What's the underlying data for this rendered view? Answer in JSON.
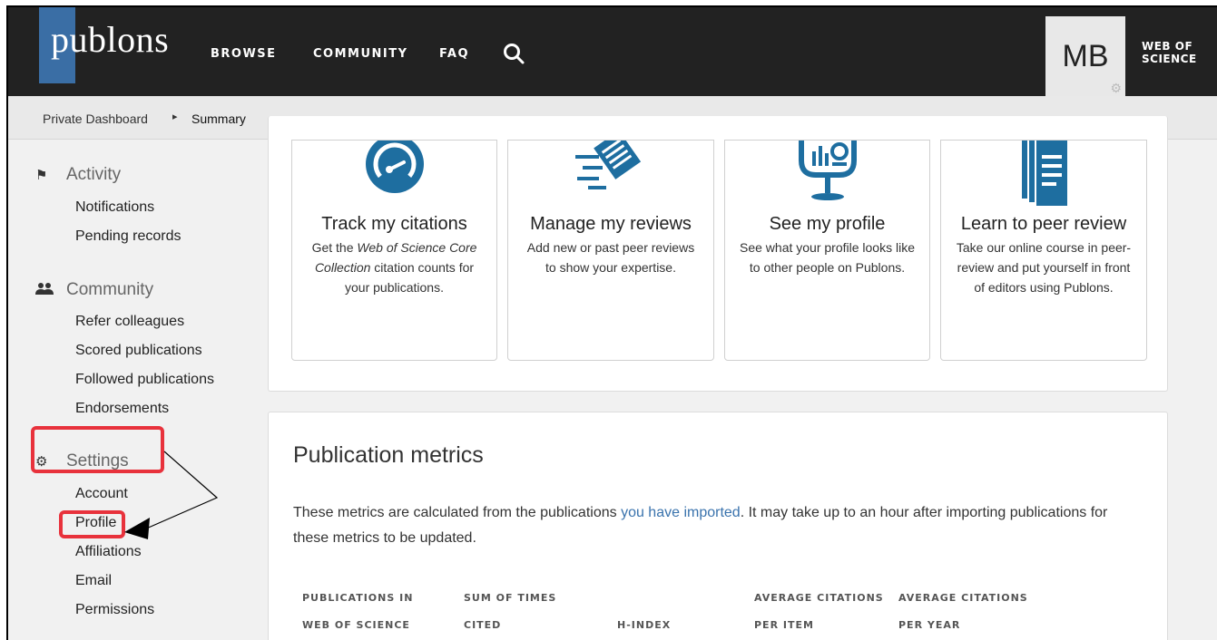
{
  "header": {
    "logo": "publons",
    "nav": [
      "BROWSE",
      "COMMUNITY",
      "FAQ"
    ],
    "avatar_initials": "MB",
    "wos_line1": "WEB OF",
    "wos_line2": "SCIENCE"
  },
  "breadcrumb": {
    "parent": "Private Dashboard",
    "current": "Summary"
  },
  "sidebar": {
    "activity": {
      "title": "Activity",
      "items": [
        "Notifications",
        "Pending records"
      ]
    },
    "community": {
      "title": "Community",
      "items": [
        "Refer colleagues",
        "Scored publications",
        "Followed publications",
        "Endorsements"
      ]
    },
    "settings": {
      "title": "Settings",
      "items": [
        "Account",
        "Profile",
        "Affiliations",
        "Email",
        "Permissions"
      ]
    }
  },
  "cards": [
    {
      "title": "Track my citations",
      "desc_pre": "Get the ",
      "desc_em": "Web of Science Core Collection",
      "desc_post": " citation counts for your publications."
    },
    {
      "title": "Manage my reviews",
      "desc": "Add new or past peer reviews to show your expertise."
    },
    {
      "title": "See my profile",
      "desc": "See what your profile looks like to other people on Publons."
    },
    {
      "title": "Learn to peer review",
      "desc": "Take our online course in peer-review and put yourself in front of editors using Publons."
    }
  ],
  "metrics": {
    "title": "Publication metrics",
    "text_pre": "These metrics are calculated from the publications ",
    "link": "you have imported",
    "text_post": ".  It may take up to an hour after importing publications for these metrics to be updated.",
    "columns": [
      {
        "line1": "PUBLICATIONS IN",
        "line2": "WEB OF SCIENCE"
      },
      {
        "line1": "SUM OF TIMES",
        "line2": "CITED"
      },
      {
        "line1": "",
        "line2": "H-INDEX"
      },
      {
        "line1": "AVERAGE CITATIONS",
        "line2": "PER ITEM"
      },
      {
        "line1": "AVERAGE CITATIONS",
        "line2": "PER YEAR"
      }
    ]
  },
  "colors": {
    "topbar": "#222222",
    "brand_blue": "#3a6ea5",
    "icon_blue": "#1e6ea0",
    "link": "#3a73ad",
    "annotation_red": "#e8323c"
  }
}
